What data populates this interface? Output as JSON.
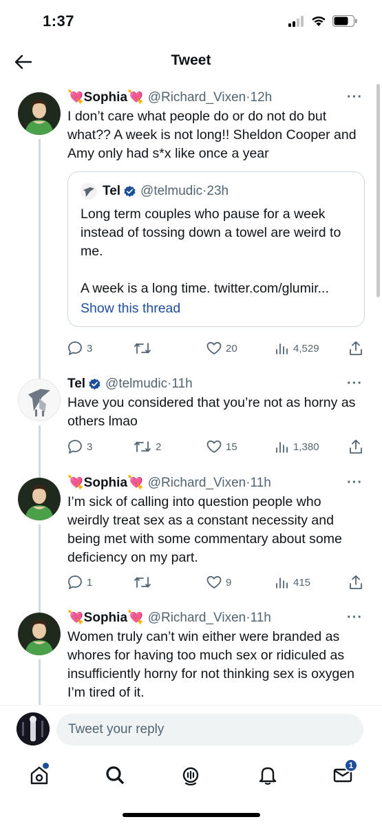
{
  "status_bar": {
    "time": "1:37"
  },
  "header": {
    "title": "Tweet"
  },
  "tweets": [
    {
      "name": "Sophia",
      "handle": "@Richard_Vixen",
      "time": "12h",
      "text": "I don’t care what people do or do not do but what?? A week is not long!! Sheldon Cooper and Amy only had s*x like once a year",
      "quote": {
        "name": "Tel",
        "handle": "@telmudic",
        "time": "23h",
        "text": "Long term couples who pause for a week instead of tossing down a towel are weird to me.\n\nA week is a long time. twitter.com/glumir...",
        "show_thread": "Show this thread"
      },
      "stats": {
        "replies": "3",
        "retweets": "",
        "likes": "20",
        "views": "4,529"
      }
    },
    {
      "name": "Tel",
      "handle": "@telmudic",
      "time": "11h",
      "text": "Have you considered that you’re not as horny as others lmao",
      "stats": {
        "replies": "3",
        "retweets": "2",
        "likes": "15",
        "views": "1,380"
      }
    },
    {
      "name": "Sophia",
      "handle": "@Richard_Vixen",
      "time": "11h",
      "text": "I’m sick of calling into question people who weirdly treat sex as a constant necessity and being met with some commentary about some deficiency on my part.",
      "stats": {
        "replies": "1",
        "retweets": "",
        "likes": "9",
        "views": "415"
      }
    },
    {
      "name": "Sophia",
      "handle": "@Richard_Vixen",
      "time": "11h",
      "text": "Women truly can’t win either were branded as whores for having too much sex or ridiculed as insufficiently horny for not thinking sex is oxygen I’m tired of it."
    }
  ],
  "reply": {
    "placeholder": "Tweet your reply"
  },
  "nav": {
    "messages_badge": "1"
  },
  "icons": {
    "name_emoji": "heart-with-arrow-icon",
    "verified": "verified-badge-icon"
  },
  "colors": {
    "link": "#1d4e9a",
    "secondary": "#536471",
    "border": "#cfd9de"
  }
}
